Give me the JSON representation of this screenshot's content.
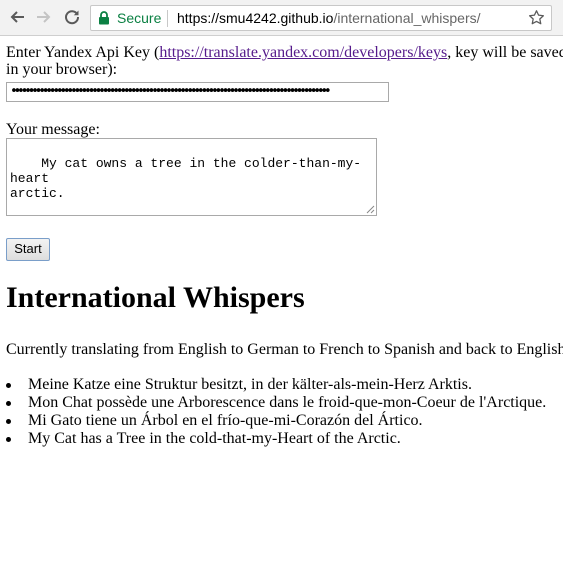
{
  "browser": {
    "secure_label": "Secure",
    "url_host": "https://smu4242.github.io",
    "url_path": "/international_whispers/",
    "icons": [
      "back-icon",
      "forward-icon",
      "reload-icon",
      "lock-icon",
      "star-icon"
    ]
  },
  "form": {
    "apikey_prefix": "Enter Yandex Api Key (",
    "apikey_link": "https://translate.yandex.com/developers/keys",
    "apikey_suffix_line1": ", key will be saved",
    "apikey_suffix_line2": "in your browser):",
    "apikey_value": "••••••••••••••••••••••••••••••••••••••••••••••••••••••••••••••••••••••••••••••••••••••••••",
    "message_label": "Your message:",
    "message_value": "My cat owns a tree in the colder-than-my-heart\narctic.",
    "start_label": "Start"
  },
  "main": {
    "title": "International Whispers",
    "status": "Currently translating from English to German to French to Spanish and back to English",
    "results": [
      "Meine Katze eine Struktur besitzt, in der kälter-als-mein-Herz Arktis.",
      "Mon Chat possède une Arborescence dans le froid-que-mon-Coeur de l'Arctique.",
      "Mi Gato tiene un Árbol en el frío-que-mi-Corazón del Ártico.",
      "My Cat has a Tree in the cold-that-my-Heart of the Arctic."
    ]
  },
  "colors": {
    "secure_green": "#0b8043",
    "link_visited": "#551a8b"
  }
}
